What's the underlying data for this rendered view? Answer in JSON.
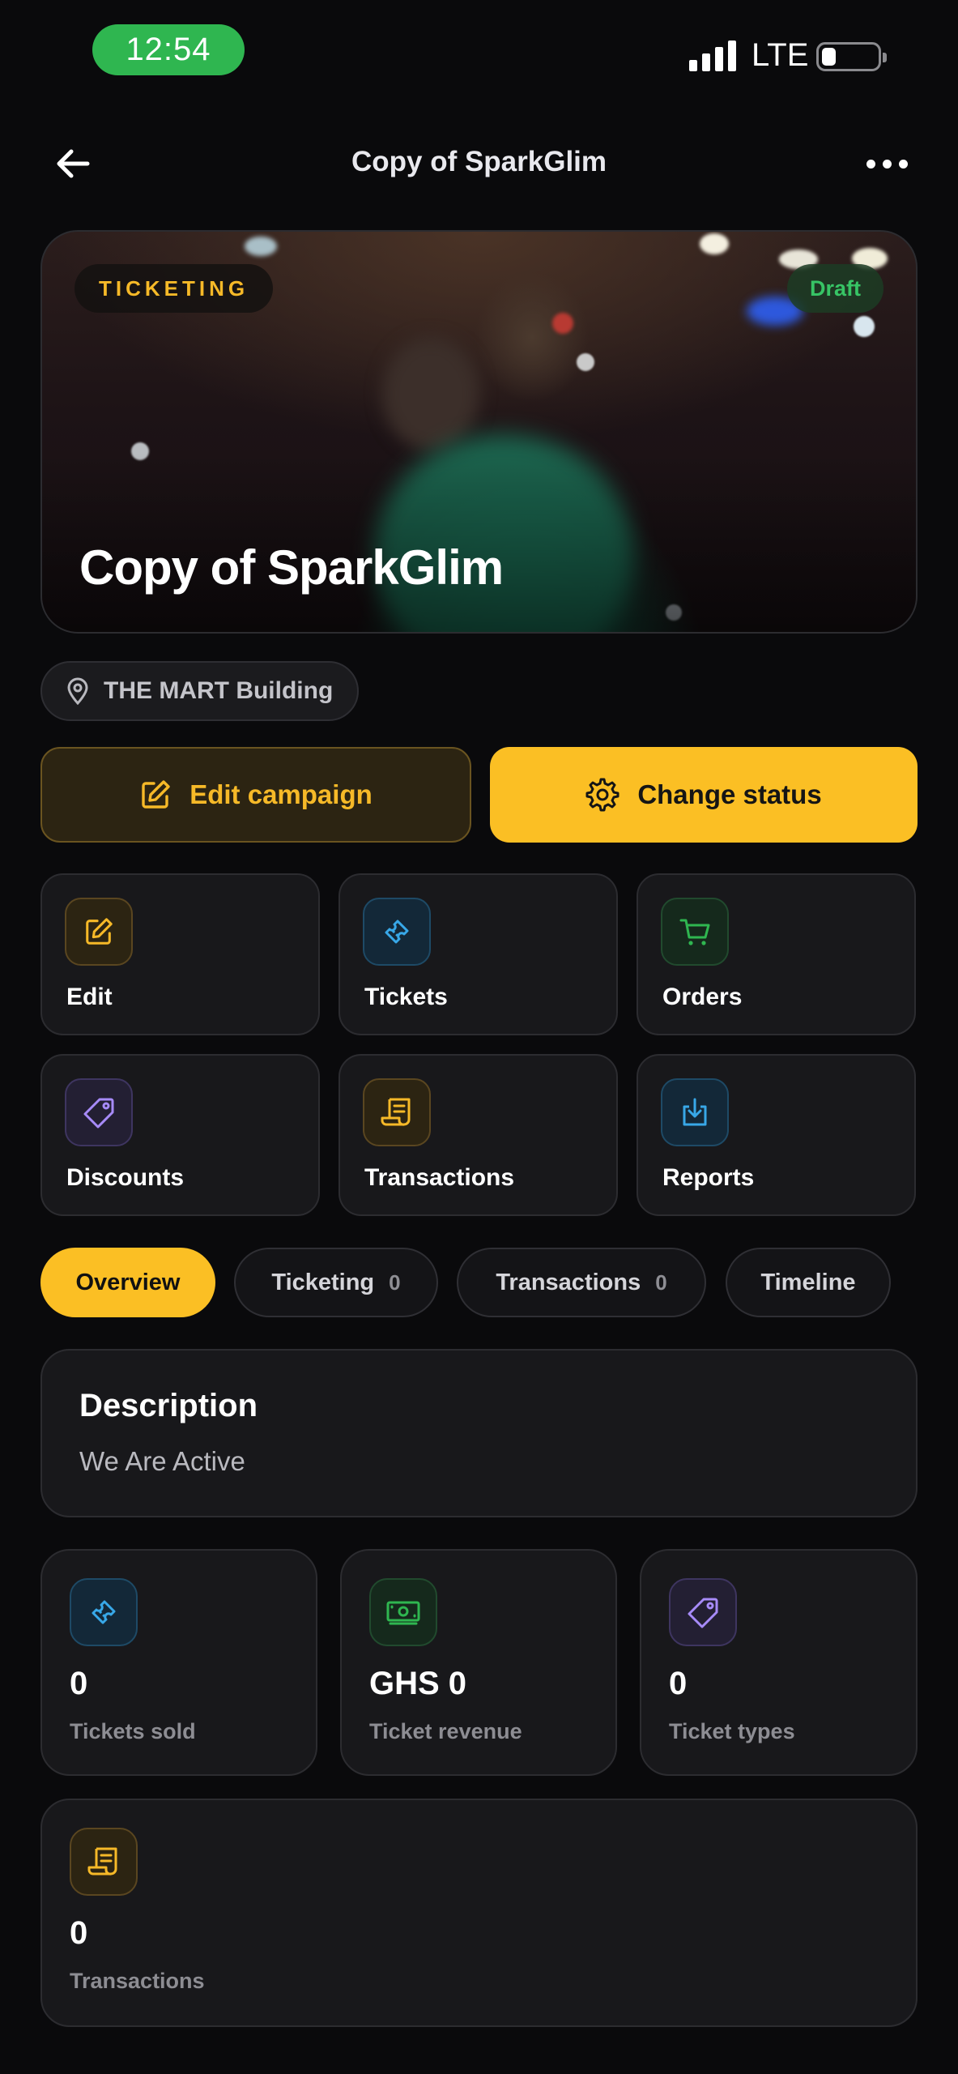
{
  "status_bar": {
    "time": "12:54",
    "network": "LTE"
  },
  "nav": {
    "title": "Copy of SparkGlim",
    "back_icon": "arrow-left-icon",
    "more_icon": "ellipsis-icon"
  },
  "hero": {
    "category_badge": "TICKETING",
    "status_badge": "Draft",
    "title": "Copy of SparkGlim"
  },
  "location": {
    "icon": "map-pin-icon",
    "text": "THE MART Building"
  },
  "actions": {
    "edit_campaign": "Edit campaign",
    "change_status": "Change status"
  },
  "quick_actions": [
    {
      "label": "Edit",
      "icon": "edit-icon",
      "color": "#f6b928"
    },
    {
      "label": "Tickets",
      "icon": "ticket-icon",
      "color": "#38a8e8"
    },
    {
      "label": "Orders",
      "icon": "cart-icon",
      "color": "#2fb650"
    },
    {
      "label": "Discounts",
      "icon": "tag-icon",
      "color": "#a78bfa"
    },
    {
      "label": "Transactions",
      "icon": "receipt-icon",
      "color": "#f6b928"
    },
    {
      "label": "Reports",
      "icon": "download-icon",
      "color": "#38a8e8"
    }
  ],
  "tabs": [
    {
      "label": "Overview",
      "count": null,
      "active": true
    },
    {
      "label": "Ticketing",
      "count": "0",
      "active": false
    },
    {
      "label": "Transactions",
      "count": "0",
      "active": false
    },
    {
      "label": "Timeline",
      "count": null,
      "active": false
    }
  ],
  "description": {
    "title": "Description",
    "text": "We Are Active"
  },
  "stats": [
    {
      "value": "0",
      "label": "Tickets sold",
      "icon": "ticket-icon"
    },
    {
      "value": "GHS 0",
      "label": "Ticket revenue",
      "icon": "banknote-icon"
    },
    {
      "value": "0",
      "label": "Ticket types",
      "icon": "tag-icon"
    },
    {
      "value": "0",
      "label": "Transactions",
      "icon": "receipt-icon"
    }
  ],
  "colors": {
    "accent": "#fbbf24",
    "draft": "#37c465",
    "background": "#0a0a0c",
    "card": "#18181b"
  }
}
